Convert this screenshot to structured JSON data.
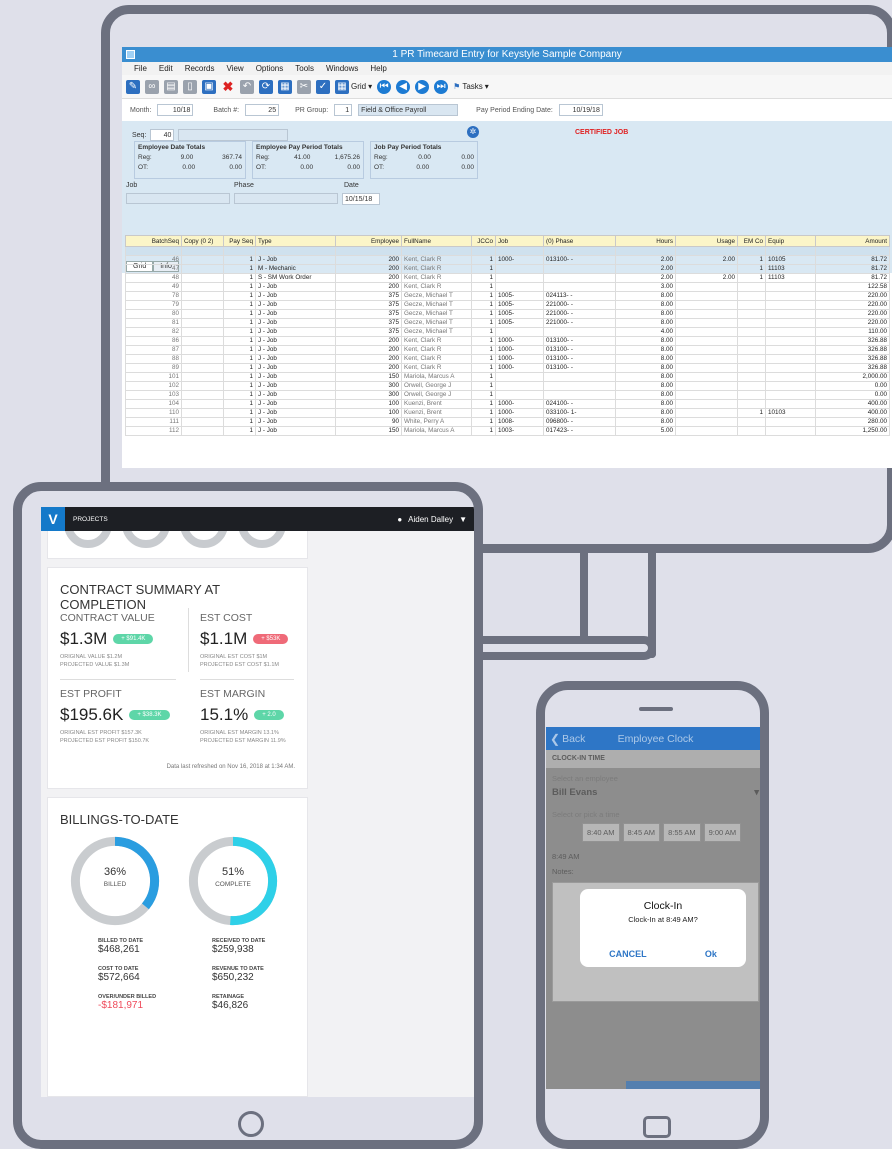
{
  "desktop": {
    "title": "1 PR Timecard Entry for Keystyle Sample Company",
    "menu": [
      "File",
      "Edit",
      "Records",
      "View",
      "Options",
      "Tools",
      "Windows",
      "Help"
    ],
    "toolbar": {
      "grid_label": "Grid",
      "tasks_label": "Tasks"
    },
    "header": {
      "month_label": "Month:",
      "month_value": "10/18",
      "batch_label": "Batch #:",
      "batch_value": "25",
      "prgroup_label": "PR Group:",
      "prgroup_value": "1",
      "prgroup_desc": "Field & Office Payroll",
      "ppe_label": "Pay Period Ending Date:",
      "ppe_value": "10/19/18"
    },
    "seq_label": "Seq:",
    "seq_value": "40",
    "certified": "CERTIFIED JOB",
    "employee_date_totals": {
      "title": "Employee Date Totals",
      "reg_label": "Reg:",
      "reg_hours": "9.00",
      "reg_amount": "367.74",
      "ot_label": "OT:",
      "ot_hours": "0.00",
      "ot_amount": "0.00"
    },
    "employee_pay_period_totals": {
      "title": "Employee Pay Period Totals",
      "reg_label": "Reg:",
      "reg_hours": "41.00",
      "reg_amount": "1,675.26",
      "ot_label": "OT:",
      "ot_hours": "0.00",
      "ot_amount": "0.00"
    },
    "job_pay_period_totals": {
      "title": "Job Pay Period Totals",
      "reg_label": "Reg:",
      "reg_hours": "0.00",
      "reg_amount": "0.00",
      "ot_label": "OT:",
      "ot_hours": "0.00",
      "ot_amount": "0.00"
    },
    "job_label": "Job",
    "phase_label": "Phase",
    "date_label": "Date",
    "date_value": "10/15/18",
    "tabs": [
      "Grid",
      "Info"
    ],
    "columns": [
      "BatchSeq",
      "Copy (0 2)",
      "Pay Seq",
      "Type",
      "Employee",
      "FullName",
      "JCCo",
      "Job",
      "(0) Phase",
      "Hours",
      "Usage",
      "EM Co",
      "Equip",
      "Amount"
    ],
    "rows": [
      [
        "46",
        "",
        "1",
        "J - Job",
        "200",
        "Kent, Clark R",
        "1",
        "1000-",
        "013100- -",
        "2.00",
        "2.00",
        "1",
        "10105",
        "81.72"
      ],
      [
        "47",
        "",
        "1",
        "M - Mechanic",
        "200",
        "Kent, Clark R",
        "1",
        "",
        "",
        "2.00",
        "",
        "1",
        "11103",
        "81.72"
      ],
      [
        "48",
        "",
        "1",
        "S - SM Work Order",
        "200",
        "Kent, Clark R",
        "1",
        "",
        "",
        "2.00",
        "2.00",
        "1",
        "11103",
        "81.72"
      ],
      [
        "49",
        "",
        "1",
        "J - Job",
        "200",
        "Kent, Clark R",
        "1",
        "",
        "",
        "3.00",
        "",
        "",
        "",
        "122.58"
      ],
      [
        "78",
        "",
        "1",
        "J - Job",
        "375",
        "Gecze, Michael T",
        "1",
        "1005-",
        "024113- -",
        "8.00",
        "",
        "",
        "",
        "220.00"
      ],
      [
        "79",
        "",
        "1",
        "J - Job",
        "375",
        "Gecze, Michael T",
        "1",
        "1005-",
        "221000- -",
        "8.00",
        "",
        "",
        "",
        "220.00"
      ],
      [
        "80",
        "",
        "1",
        "J - Job",
        "375",
        "Gecze, Michael T",
        "1",
        "1005-",
        "221000- -",
        "8.00",
        "",
        "",
        "",
        "220.00"
      ],
      [
        "81",
        "",
        "1",
        "J - Job",
        "375",
        "Gecze, Michael T",
        "1",
        "1005-",
        "221000- -",
        "8.00",
        "",
        "",
        "",
        "220.00"
      ],
      [
        "82",
        "",
        "1",
        "J - Job",
        "375",
        "Gecze, Michael T",
        "1",
        "",
        "",
        "4.00",
        "",
        "",
        "",
        "110.00"
      ],
      [
        "86",
        "",
        "1",
        "J - Job",
        "200",
        "Kent, Clark R",
        "1",
        "1000-",
        "013100- -",
        "8.00",
        "",
        "",
        "",
        "326.88"
      ],
      [
        "87",
        "",
        "1",
        "J - Job",
        "200",
        "Kent, Clark R",
        "1",
        "1000-",
        "013100- -",
        "8.00",
        "",
        "",
        "",
        "326.88"
      ],
      [
        "88",
        "",
        "1",
        "J - Job",
        "200",
        "Kent, Clark R",
        "1",
        "1000-",
        "013100- -",
        "8.00",
        "",
        "",
        "",
        "326.88"
      ],
      [
        "89",
        "",
        "1",
        "J - Job",
        "200",
        "Kent, Clark R",
        "1",
        "1000-",
        "013100- -",
        "8.00",
        "",
        "",
        "",
        "326.88"
      ],
      [
        "101",
        "",
        "1",
        "J - Job",
        "150",
        "Mariola, Marcus A",
        "1",
        "",
        "",
        "8.00",
        "",
        "",
        "",
        "2,000.00"
      ],
      [
        "102",
        "",
        "1",
        "J - Job",
        "300",
        "Orwell, George J",
        "1",
        "",
        "",
        "8.00",
        "",
        "",
        "",
        "0.00"
      ],
      [
        "103",
        "",
        "1",
        "J - Job",
        "300",
        "Orwell, George J",
        "1",
        "",
        "",
        "8.00",
        "",
        "",
        "",
        "0.00"
      ],
      [
        "104",
        "",
        "1",
        "J - Job",
        "100",
        "Kuenzi, Brent",
        "1",
        "1000-",
        "024100- -",
        "8.00",
        "",
        "",
        "",
        "400.00"
      ],
      [
        "110",
        "",
        "1",
        "J - Job",
        "100",
        "Kuenzi, Brent",
        "1",
        "1000-",
        "033100- 1-",
        "8.00",
        "",
        "1",
        "10103",
        "400.00"
      ],
      [
        "111",
        "",
        "1",
        "J - Job",
        "90",
        "White, Perry A",
        "1",
        "1008-",
        "096800- -",
        "8.00",
        "",
        "",
        "",
        "280.00"
      ],
      [
        "112",
        "",
        "1",
        "J - Job",
        "150",
        "Mariola, Marcus A",
        "1",
        "1003-",
        "017423- -",
        "5.00",
        "",
        "",
        "",
        "1,250.00"
      ]
    ]
  },
  "tablet": {
    "nav_label": "PROJECTS",
    "user": "Aiden Dalley",
    "contract_summary": {
      "title": "CONTRACT SUMMARY AT COMPLETION",
      "contract_value": {
        "label": "CONTRACT VALUE",
        "value": "$1.3M",
        "delta": "+ $91.4K",
        "line1": "ORIGINAL VALUE $1.2M",
        "line2": "PROJECTED VALUE $1.3M"
      },
      "est_cost": {
        "label": "EST COST",
        "value": "$1.1M",
        "delta": "+ $53K",
        "line1": "ORIGINAL EST COST $1M",
        "line2": "PROJECTED EST COST $1.1M"
      },
      "est_profit": {
        "label": "EST PROFIT",
        "value": "$195.6K",
        "delta": "+ $38.3K",
        "line1": "ORIGINAL EST PROFIT $157.3K",
        "line2": "PROJECTED EST PROFIT $150.7K"
      },
      "est_margin": {
        "label": "EST MARGIN",
        "value": "15.1%",
        "delta": "+ 2.0",
        "line1": "ORIGINAL EST MARGIN 13.1%",
        "line2": "PROJECTED EST MARGIN 11.9%"
      },
      "refreshed": "Data last refreshed on Nov 16, 2018 at 1:34 AM."
    },
    "billings": {
      "title": "BILLINGS-TO-DATE",
      "billed_pct": 36,
      "billed_pct_text": "36%",
      "billed_text": "BILLED",
      "complete_pct": 51,
      "complete_pct_text": "51%",
      "complete_text": "COMPLETE",
      "billed_to_date_label": "BILLED TO DATE",
      "billed_to_date": "$468,261",
      "received_to_date_label": "RECEIVED TO DATE",
      "received_to_date": "$259,938",
      "cost_to_date_label": "COST TO DATE",
      "cost_to_date": "$572,664",
      "revenue_to_date_label": "REVENUE TO DATE",
      "revenue_to_date": "$650,232",
      "over_under_label": "OVER/UNDER BILLED",
      "over_under": "-$181,971",
      "retainage_label": "RETAINAGE",
      "retainage": "$46,826"
    },
    "colors": {
      "accent": "#2a9de0",
      "cyan": "#2ed0e8",
      "green": "#5ed6a8",
      "red": "#ef6a78"
    }
  },
  "phone": {
    "back_label": "Back",
    "title": "Employee Clock",
    "section": "CLOCK-IN TIME",
    "employee_placeholder": "Select an employee",
    "employee_value": "Bill Evans",
    "time_label": "Select or pick a time",
    "times": [
      "8:40 AM",
      "8:45 AM",
      "8:55 AM",
      "9:00 AM"
    ],
    "selected_time": "8:49 AM",
    "notes_label": "Notes:",
    "dialog": {
      "title": "Clock-In",
      "message": "Clock-In at 8:49 AM?",
      "cancel": "CANCEL",
      "ok": "Ok"
    }
  }
}
